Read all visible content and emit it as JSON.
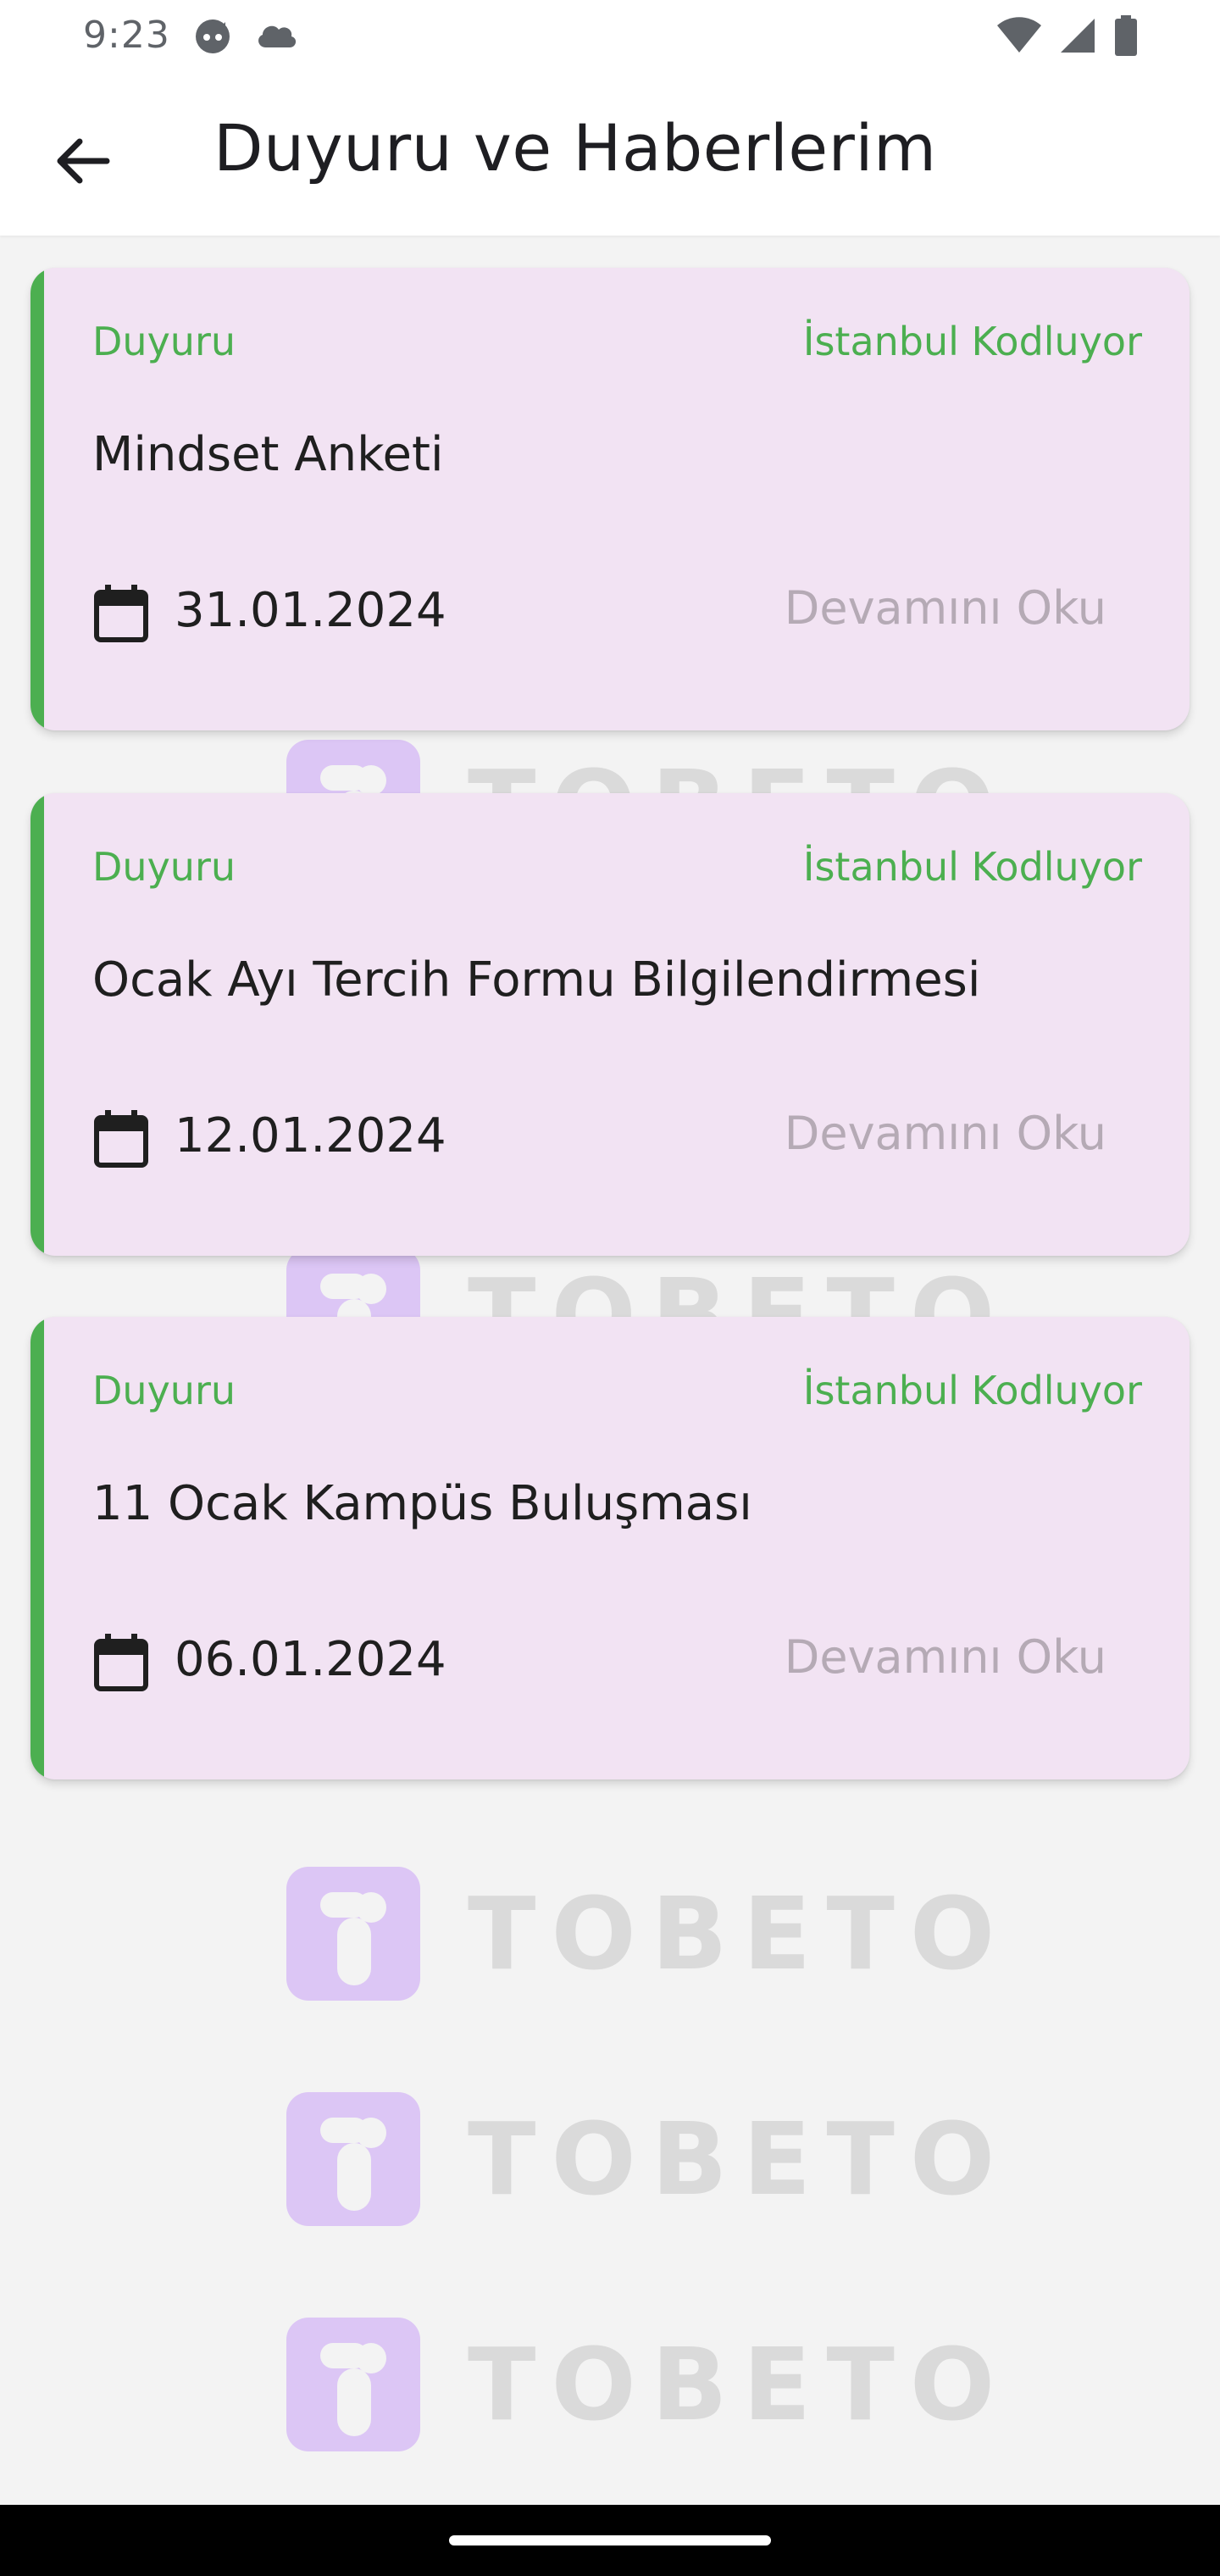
{
  "status_bar": {
    "time": "9:23",
    "icons": [
      "face-icon",
      "cloud-icon",
      "wifi-icon",
      "signal-icon",
      "battery-icon"
    ]
  },
  "app_bar": {
    "title": "Duyuru ve Haberlerim",
    "back_icon": "arrow-left-icon"
  },
  "colors": {
    "accent_green": "#4caf50",
    "card_background": "#f2e3f3",
    "muted_text": "#b5aab5",
    "watermark_logo": "#dcc6f5"
  },
  "watermark": {
    "text": "TOBETO"
  },
  "announcements": [
    {
      "type": "Duyuru",
      "organization": "İstanbul Kodluyor",
      "title": "Mindset Anketi",
      "date": "31.01.2024",
      "read_more": "Devamını Oku"
    },
    {
      "type": "Duyuru",
      "organization": "İstanbul Kodluyor",
      "title": "Ocak Ayı Tercih Formu Bilgilendirmesi",
      "date": "12.01.2024",
      "read_more": "Devamını Oku"
    },
    {
      "type": "Duyuru",
      "organization": "İstanbul Kodluyor",
      "title": "11 Ocak Kampüs Buluşması",
      "date": "06.01.2024",
      "read_more": "Devamını Oku"
    }
  ]
}
